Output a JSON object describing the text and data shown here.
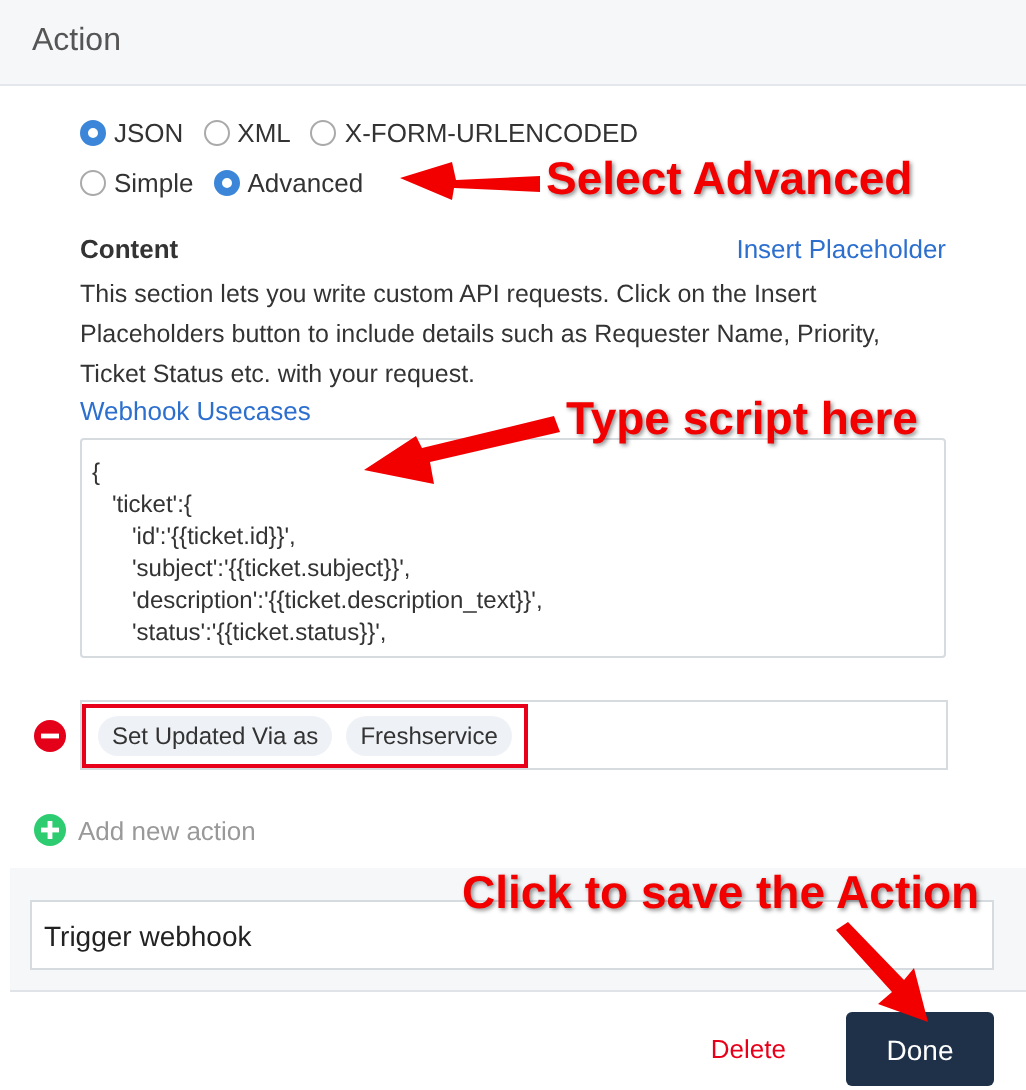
{
  "header": {
    "title": "Action"
  },
  "formats": [
    {
      "label": "JSON",
      "selected": true
    },
    {
      "label": "XML",
      "selected": false
    },
    {
      "label": "X-FORM-URLENCODED",
      "selected": false
    }
  ],
  "modes": [
    {
      "label": "Simple",
      "selected": false
    },
    {
      "label": "Advanced",
      "selected": true
    }
  ],
  "content": {
    "label": "Content",
    "insert_link": "Insert Placeholder",
    "description": "This section lets you write custom API requests. Click on the Insert Placeholders button to include details such as Requester Name, Priority, Ticket Status etc. with your request.",
    "usecases_link": "Webhook Usecases",
    "code_lines": [
      "{",
      "   'ticket':{",
      "      'id':'{{ticket.id}}',",
      "      'subject':'{{ticket.subject}}',",
      "      'description':'{{ticket.description_text}}',",
      "      'status':'{{ticket.status}}',"
    ]
  },
  "action": {
    "chips": [
      "Set Updated Via as",
      "Freshservice"
    ],
    "highlighted": true
  },
  "add_action": "Add new action",
  "trigger": {
    "value": "Trigger webhook"
  },
  "buttons": [
    {
      "label": "Delete",
      "kind": "link"
    },
    {
      "label": "Done",
      "kind": "primary"
    }
  ],
  "annotations": [
    "Select Advanced",
    "Type script here",
    "Click to save the Action"
  ]
}
